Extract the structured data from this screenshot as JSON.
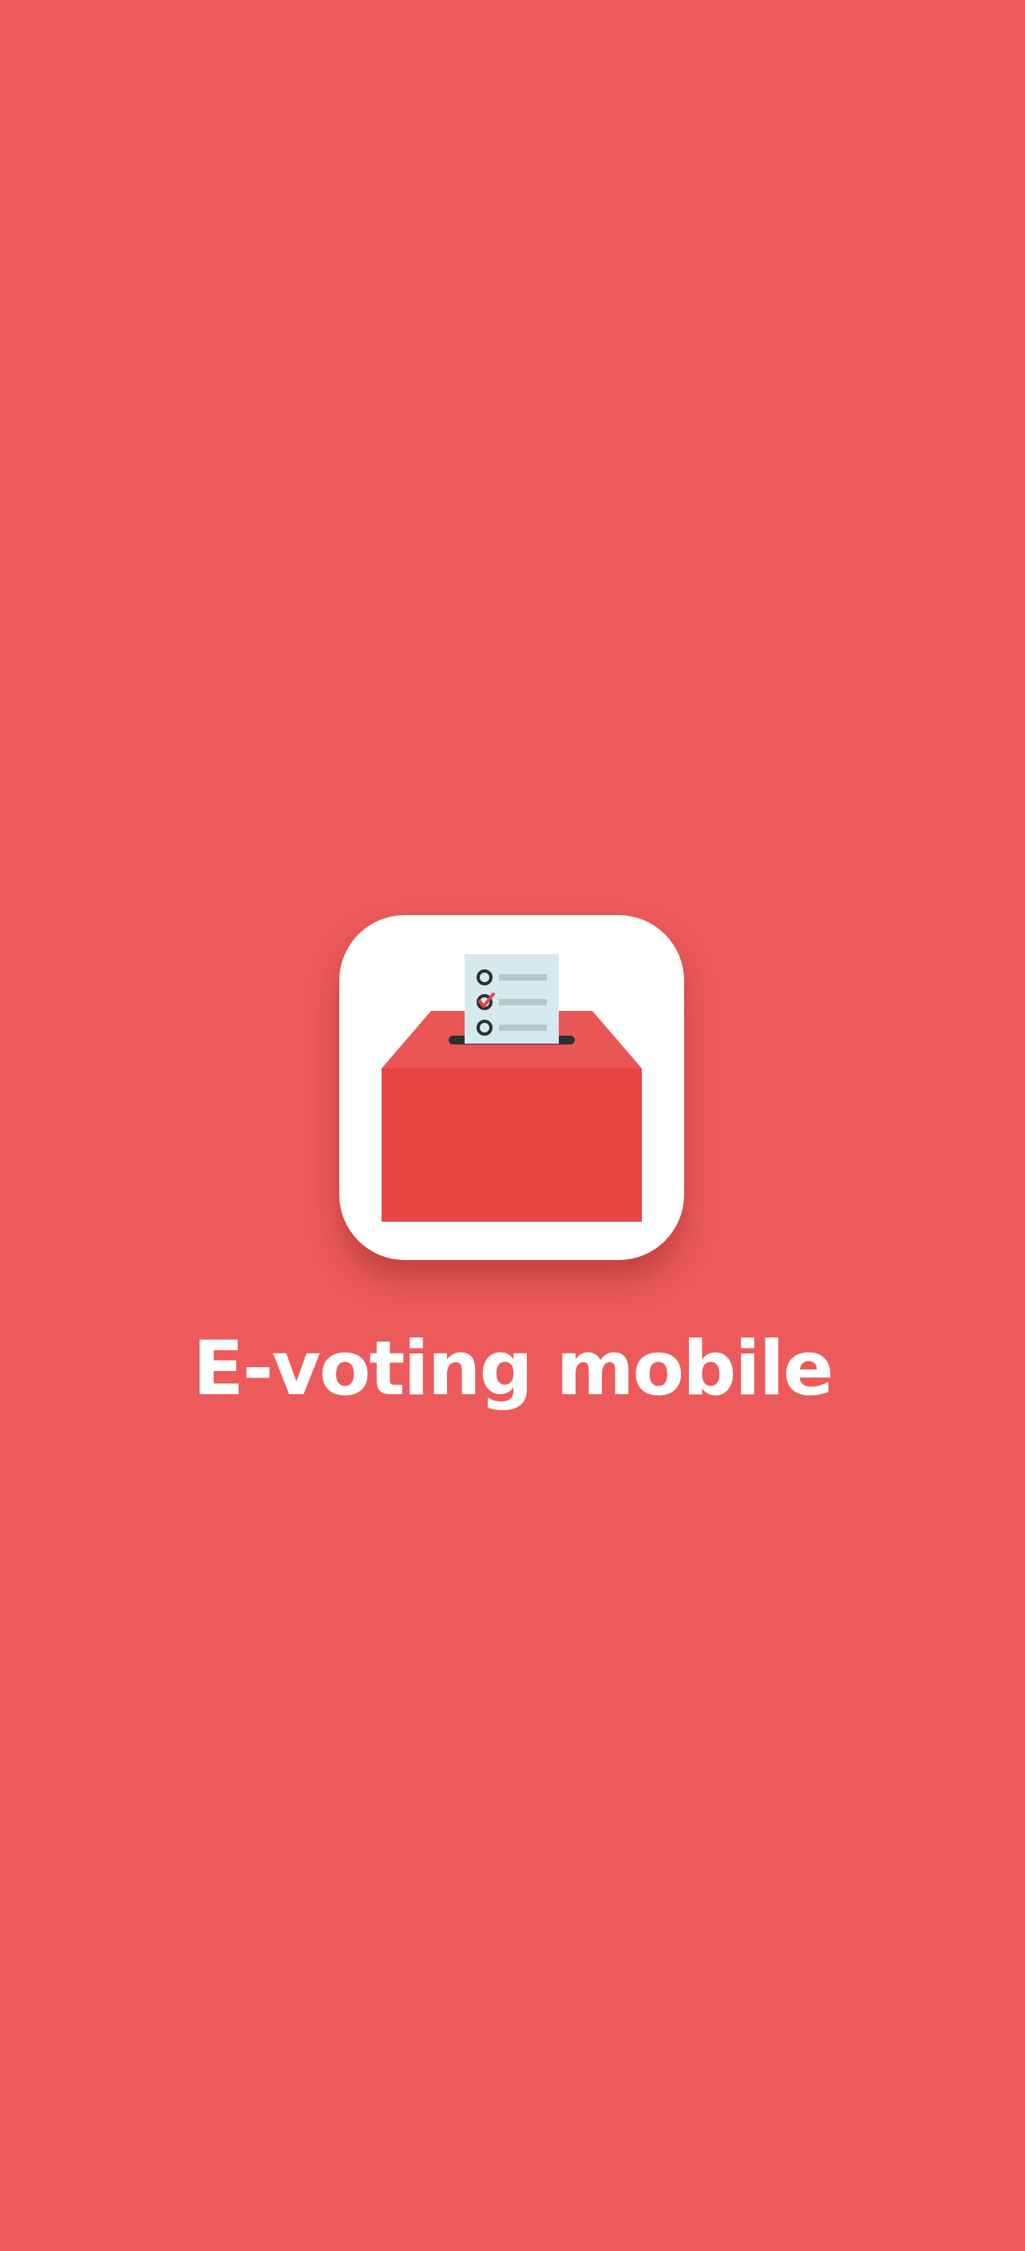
{
  "app": {
    "title": "E-voting mobile",
    "icon": "ballot-box-icon"
  },
  "colors": {
    "background": "#EC5A5B",
    "icon_tile": "#FFFFFF",
    "box_front": "#E84444",
    "box_lid": "#EA5555",
    "ballot_paper": "#D6E9EE",
    "ballot_lines": "#AFC9CF",
    "check_mark": "#E84444",
    "slot": "#2B2F36",
    "title_text": "#FFFFFF"
  }
}
